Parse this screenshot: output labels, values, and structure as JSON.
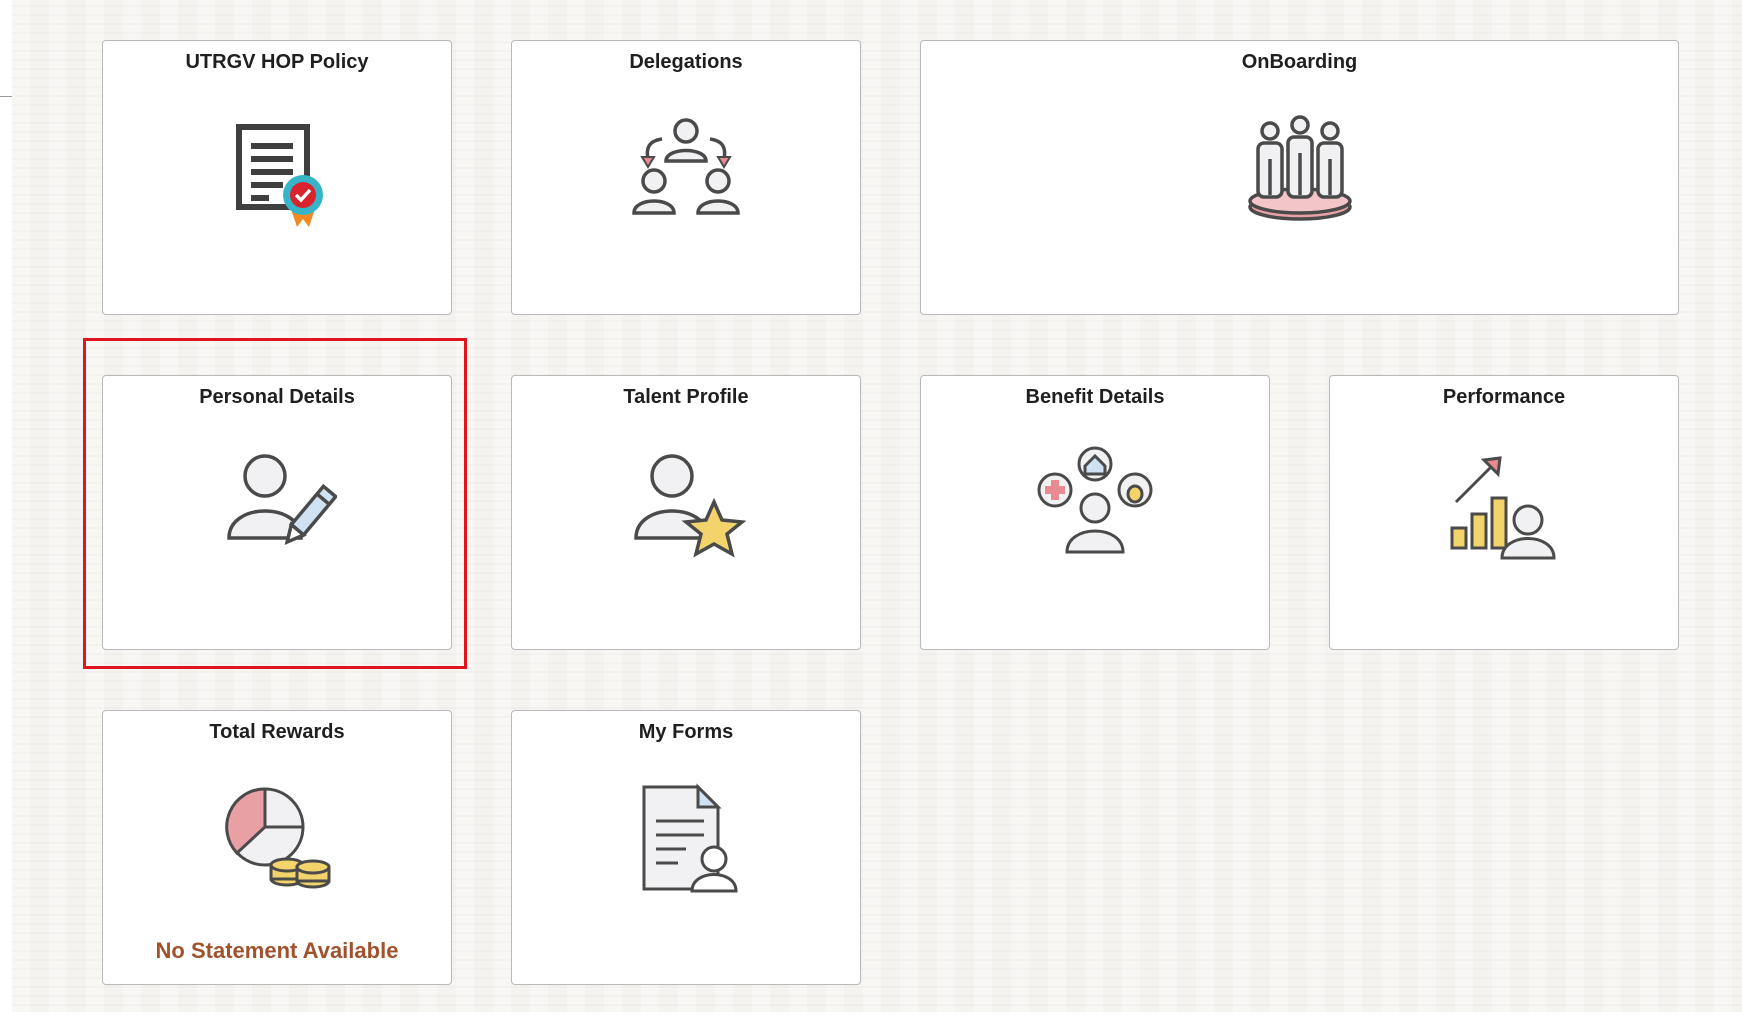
{
  "tiles": [
    {
      "id": "utrgv-hop-policy",
      "title": "UTRGV HOP Policy",
      "icon": "certificate-icon"
    },
    {
      "id": "delegations",
      "title": "Delegations",
      "icon": "delegation-icon"
    },
    {
      "id": "onboarding",
      "title": "OnBoarding",
      "icon": "team-group-icon"
    },
    {
      "id": "personal-details",
      "title": "Personal Details",
      "icon": "person-edit-icon",
      "highlighted": true
    },
    {
      "id": "talent-profile",
      "title": "Talent Profile",
      "icon": "person-star-icon"
    },
    {
      "id": "benefit-details",
      "title": "Benefit Details",
      "icon": "benefits-icon"
    },
    {
      "id": "performance",
      "title": "Performance",
      "icon": "performance-chart-icon"
    },
    {
      "id": "total-rewards",
      "title": "Total Rewards",
      "icon": "pie-coins-icon",
      "status": "No Statement Available"
    },
    {
      "id": "my-forms",
      "title": "My Forms",
      "icon": "form-person-icon"
    }
  ],
  "colors": {
    "status_text": "#a0522d",
    "highlight_border": "#e0141f",
    "icon_stroke": "#4a4a4a",
    "icon_fill": "#f1f1f3",
    "accent_pink": "#e8a0a4",
    "accent_gold": "#f3d36b",
    "accent_blue": "#cfe2f3"
  }
}
